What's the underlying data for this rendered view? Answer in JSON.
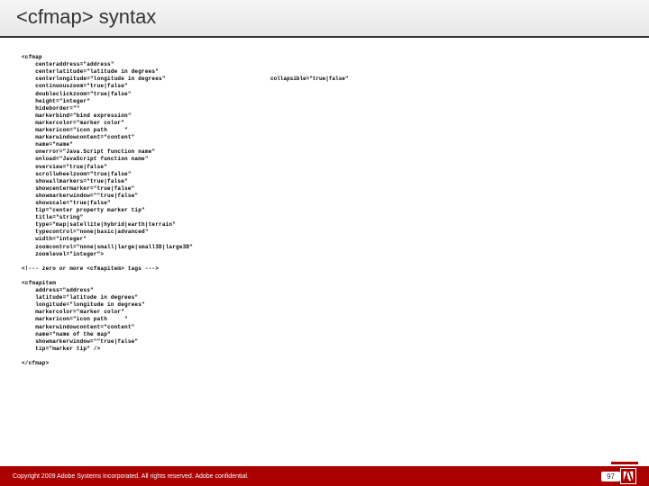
{
  "slide": {
    "title": "<cfmap> syntax"
  },
  "code": {
    "open_tag": "<cfmap",
    "attr1": "    centeraddress=\"address\"",
    "attr2": "    centerlatitude=\"latitude in degrees\"",
    "attr3": "    centerlongitude=\"longitude in degrees\"",
    "attr_collapsible": "collapsible=\"true|false\"",
    "attr4": "    continuouszoom=\"true|false\"",
    "attr5": "    doubleclickzoom=\"true|false\"",
    "attr6": "    height=\"integer\"",
    "attr7": "    hideborder=\"\"",
    "attr8": "    markerbind=\"bind expression\"",
    "attr9": "    markercolor=\"marker color\"",
    "attr10": "    markericon=\"icon path     \"",
    "attr11": "    markerwindowcontent=\"content\"",
    "attr12": "    name=\"name\"",
    "attr13": "    onerror=\"Java.Script function name\"",
    "attr14": "    onload=\"JavaScript function name\"",
    "attr15": "    overview=\"true|false\"",
    "attr16": "    scrollwheelzoom=\"true|false\"",
    "attr17": "    showallmarkers=\"true|false\"",
    "attr18": "    showcentermarker=\"true|false\"",
    "attr19": "    showmarkerwindow=\"\"true|false\"",
    "attr20": "    showscale=\"true|false\"",
    "attr21": "    tip=\"center property marker tip\"",
    "attr22": "    title=\"string\"",
    "attr23": "    type=\"map|satellite|hybrid|earth|terrain\"",
    "attr24": "    typecontrol=\"none|basic|advanced\"",
    "attr25": "    width=\"integer\"",
    "attr26": "    zoomcontrol=\"none|small|large|small3D|large3D\"",
    "attr27": "    zoomlevel=\"integer\">",
    "comment": "<!--- zero or more <cfmapitem> tags --->",
    "item_open": "<cfmapitem",
    "item1": "    address=\"address\"",
    "item2": "    latitude=\"latitude in degrees\"",
    "item3": "    longitude=\"longitude in degrees\"",
    "item4": "    markercolor=\"marker color\"",
    "item5": "    markericon=\"icon path     \"",
    "item6": "    markerwindowcontent=\"content\"",
    "item7": "    name=\"name of the map\"",
    "item8": "    showmarkerwindow=\"\"true|false\"",
    "item9": "    tip=\"marker tip\" />",
    "close_tag": "</cfmap>"
  },
  "footer": {
    "copyright": "Copyright 2009 Adobe Systems Incorporated.  All rights reserved.  Adobe confidential.",
    "page": "97"
  }
}
